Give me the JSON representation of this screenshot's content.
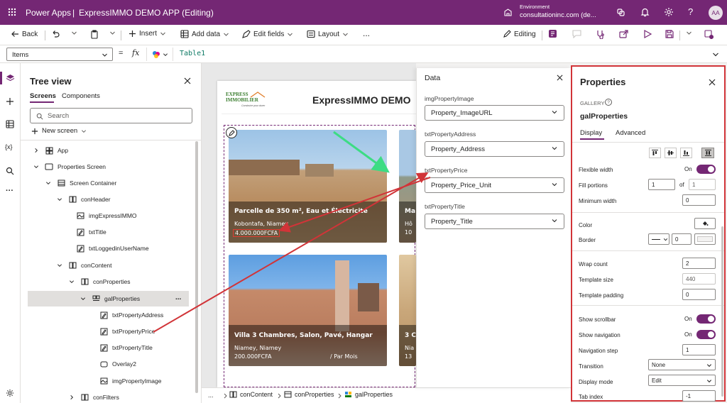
{
  "titlebar": {
    "app": "Power Apps",
    "separator": "|",
    "project": "ExpressIMMO DEMO APP (Editing)",
    "environment_label": "Environment",
    "environment_value": "consultationinc.com (de...",
    "avatar": "AA"
  },
  "commandbar": {
    "back": "Back",
    "insert": "Insert",
    "add_data": "Add data",
    "edit_fields": "Edit fields",
    "layout": "Layout",
    "more": "...",
    "editing": "Editing"
  },
  "formula": {
    "property": "Items",
    "fx": "fx",
    "value": "Table1"
  },
  "tree": {
    "title": "Tree view",
    "tabs": [
      "Screens",
      "Components"
    ],
    "search_placeholder": "Search",
    "new_screen": "New screen",
    "nodes": [
      {
        "label": "App",
        "icon": "app-icon"
      },
      {
        "label": "Properties Screen",
        "icon": "screen-icon"
      },
      {
        "label": "Screen Container",
        "icon": "container-icon"
      },
      {
        "label": "conHeader",
        "icon": "container-icon"
      },
      {
        "label": "imgExpressIMMO",
        "icon": "image-icon"
      },
      {
        "label": "txtTitle",
        "icon": "label-icon"
      },
      {
        "label": "txtLoggedinUserName",
        "icon": "label-icon"
      },
      {
        "label": "conContent",
        "icon": "container-icon"
      },
      {
        "label": "conProperties",
        "icon": "container-icon"
      },
      {
        "label": "galProperties",
        "icon": "gallery-icon",
        "menu": "..."
      },
      {
        "label": "txtPropertyAddress",
        "icon": "label-icon"
      },
      {
        "label": "txtPropertyPrice",
        "icon": "label-icon"
      },
      {
        "label": "txtPropertyTitle",
        "icon": "label-icon"
      },
      {
        "label": "Overlay2",
        "icon": "rectangle-icon"
      },
      {
        "label": "imgPropertyImage",
        "icon": "image-icon"
      },
      {
        "label": "conFilters",
        "icon": "container-icon"
      }
    ]
  },
  "canvas": {
    "logo_line1": "EXPRESS",
    "logo_line2": "IMMOBILIER",
    "logo_tagline": "Construire pour durer",
    "app_title": "ExpressIMMO DEMO",
    "cards": [
      {
        "title": "Parcelle de 350 m², Eau et Électricité",
        "address": "Kobontafa, Niamey",
        "price": "4.000.000FCFA",
        "unit": ""
      },
      {
        "title": "Ma",
        "address": "Hô",
        "price": "10",
        "unit": ""
      },
      {
        "title": "Villa 3 Chambres, Salon, Pavé, Hangar",
        "address": "Niamey, Niamey",
        "price": "200.000FCFA",
        "unit": "/ Par Mois"
      },
      {
        "title": "3 C",
        "address": "Nia",
        "price": "13",
        "unit": ""
      }
    ]
  },
  "breadcrumbs": {
    "more": "...",
    "items": [
      "conContent",
      "conProperties",
      "galProperties"
    ]
  },
  "data_pane": {
    "title": "Data",
    "fields": [
      {
        "label": "imgPropertyImage",
        "value": "Property_ImageURL"
      },
      {
        "label": "txtPropertyAddress",
        "value": "Property_Address"
      },
      {
        "label": "txtPropertyPrice",
        "value": "Property_Price_Unit"
      },
      {
        "label": "txtPropertyTitle",
        "value": "Property_Title"
      }
    ]
  },
  "properties": {
    "title": "Properties",
    "type": "GALLERY",
    "name": "galProperties",
    "tabs": [
      "Display",
      "Advanced"
    ],
    "flexible_width_label": "Flexible width",
    "flexible_width_state": "On",
    "fill_portions_label": "Fill portions",
    "fill_portions_value": "1",
    "fill_portions_of": "of",
    "fill_portions_total": "1",
    "min_width_label": "Minimum width",
    "min_width_value": "0",
    "color_label": "Color",
    "border_label": "Border",
    "border_width": "0",
    "wrap_count_label": "Wrap count",
    "wrap_count_value": "2",
    "template_size_label": "Template size",
    "template_size_value": "440",
    "template_padding_label": "Template padding",
    "template_padding_value": "0",
    "show_scrollbar_label": "Show scrollbar",
    "show_scrollbar_state": "On",
    "show_navigation_label": "Show navigation",
    "show_navigation_state": "On",
    "navigation_step_label": "Navigation step",
    "navigation_step_value": "1",
    "transition_label": "Transition",
    "transition_value": "None",
    "display_mode_label": "Display mode",
    "display_mode_value": "Edit",
    "tab_index_label": "Tab index",
    "tab_index_value": "-1"
  },
  "colors": {
    "brand": "#742774",
    "annotation_red": "#d13438",
    "annotation_green": "#3ddc84",
    "price_highlight": "#e03c31"
  }
}
